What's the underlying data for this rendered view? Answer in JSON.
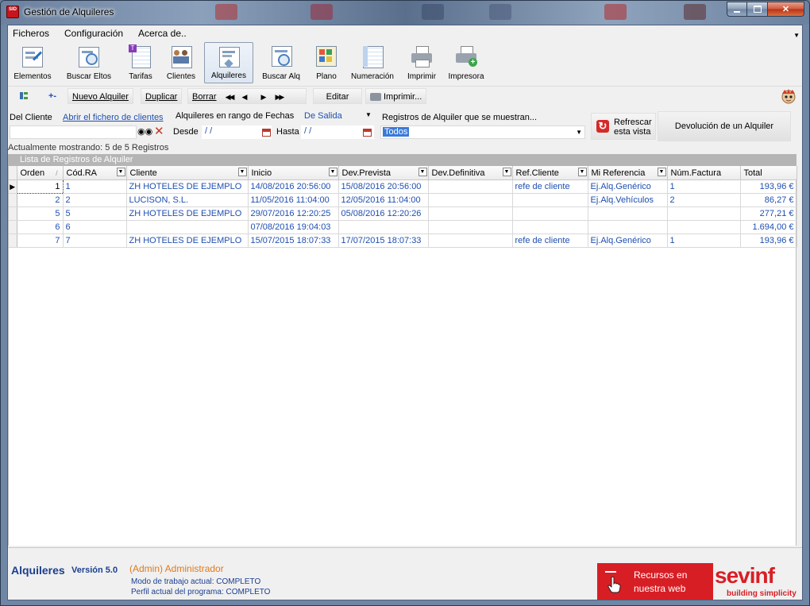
{
  "window": {
    "title": "Gestión de Alquileres",
    "app_icon_text": "SID"
  },
  "menu": [
    "Ficheros",
    "Configuración",
    "Acerca de.."
  ],
  "ribbon": [
    {
      "label": "Elementos",
      "icon": "elements-icon"
    },
    {
      "label": "Buscar Eltos",
      "icon": "search-elements-icon"
    },
    {
      "label": "Tarifas",
      "icon": "rates-icon"
    },
    {
      "label": "Clientes",
      "icon": "clients-icon"
    },
    {
      "label": "Alquileres",
      "icon": "rentals-icon",
      "active": true
    },
    {
      "label": "Buscar Alq",
      "icon": "search-rentals-icon"
    },
    {
      "label": "Plano",
      "icon": "plan-icon"
    },
    {
      "label": "Numeración",
      "icon": "numbering-icon"
    },
    {
      "label": "Imprimir",
      "icon": "print-icon"
    },
    {
      "label": "Impresora",
      "icon": "printer-add-icon"
    }
  ],
  "toolbar": {
    "nuevo": "Nuevo Alquiler",
    "duplicar": "Duplicar",
    "borrar": "Borrar",
    "first": "◀◀",
    "prev": "◀",
    "next": "▶",
    "last": "▶▶",
    "editar": "Editar",
    "imprimir": "Imprimir..."
  },
  "filters": {
    "del_cliente": "Del Cliente",
    "abrir_link": "Abrir el fichero de clientes",
    "rango_label": "Alquileres en rango de Fechas",
    "rango_value": "De Salida",
    "desde_label": "Desde",
    "desde_value": "/ /",
    "hasta_label": "Hasta",
    "hasta_value": "/ /",
    "registros_label": "Registros de Alquiler que se muestran...",
    "registros_value": "Todos",
    "refrescar_line1": "Refrescar",
    "refrescar_line2": "esta vista",
    "devolucion": "Devolución de un Alquiler"
  },
  "status": "Actualmente mostrando: 5 de 5 Registros",
  "grid": {
    "caption": "Lista de Registros de Alquiler",
    "columns": [
      "Orden",
      "Cód.RA",
      "Cliente",
      "Inicio",
      "Dev.Prevista",
      "Dev.Definitiva",
      "Ref.Cliente",
      "Mi Referencia",
      "Núm.Factura",
      "Total"
    ],
    "rows": [
      {
        "orden": "1",
        "cod": "1",
        "cliente": "ZH HOTELES DE EJEMPLO",
        "inicio": "14/08/2016 20:56:00",
        "prevista": "15/08/2016 20:56:00",
        "definitiva": "",
        "refcli": "refe de cliente",
        "miref": "Ej.Alq.Genérico",
        "factura": "1",
        "total": "193,96 €"
      },
      {
        "orden": "2",
        "cod": "2",
        "cliente": "LUCISON, S.L.",
        "inicio": "11/05/2016 11:04:00",
        "prevista": "12/05/2016 11:04:00",
        "definitiva": "",
        "refcli": "",
        "miref": "Ej.Alq.Vehículos",
        "factura": "2",
        "total": "86,27 €"
      },
      {
        "orden": "5",
        "cod": "5",
        "cliente": "ZH HOTELES DE EJEMPLO",
        "inicio": "29/07/2016 12:20:25",
        "prevista": "05/08/2016 12:20:26",
        "definitiva": "",
        "refcli": "",
        "miref": "",
        "factura": "",
        "total": "277,21 €"
      },
      {
        "orden": "6",
        "cod": "6",
        "cliente": "",
        "inicio": "07/08/2016 19:04:03",
        "prevista": "",
        "definitiva": "",
        "refcli": "",
        "miref": "",
        "factura": "",
        "total": "1.694,00 €"
      },
      {
        "orden": "7",
        "cod": "7",
        "cliente": "ZH HOTELES DE EJEMPLO",
        "inicio": "15/07/2015 18:07:33",
        "prevista": "17/07/2015 18:07:33",
        "definitiva": "",
        "refcli": "refe de cliente",
        "miref": "Ej.Alq.Genérico",
        "factura": "1",
        "total": "193,96 €"
      }
    ]
  },
  "footer": {
    "app": "Alquileres",
    "version": "Versión 5.0",
    "user": "(Admin) Administrador",
    "mode": "Modo de trabajo actual: COMPLETO",
    "profile": "Perfil actual del programa: COMPLETO",
    "recursos_line1": "Recursos en",
    "recursos_line2": "nuestra web",
    "brand": "sevinf",
    "brand_sub": "building simplicity"
  },
  "colors": {
    "accent_red": "#d81e25",
    "link_blue": "#1f4fb0",
    "user_orange": "#e07a1a"
  }
}
